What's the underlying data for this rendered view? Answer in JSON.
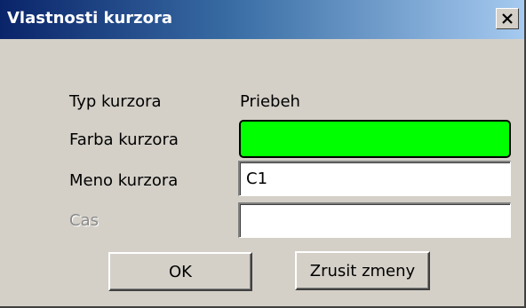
{
  "window": {
    "title": "Vlastnosti kurzora",
    "close_symbol": "×"
  },
  "rows": {
    "type": {
      "label": "Typ kurzora",
      "value": "Priebeh"
    },
    "color": {
      "label": "Farba kurzora",
      "value_color": "#00ff00"
    },
    "name": {
      "label": "Meno kurzora",
      "value": "C1"
    },
    "time": {
      "label": "Cas",
      "value": "",
      "disabled": true
    }
  },
  "buttons": {
    "ok_label": "OK",
    "cancel_label": "Zrusit zmeny"
  },
  "colors": {
    "dialog_bg": "#d4d0c8",
    "title_gradient_start": "#0a246a",
    "title_gradient_end": "#a6caf0",
    "cursor_color": "#00ff00"
  }
}
